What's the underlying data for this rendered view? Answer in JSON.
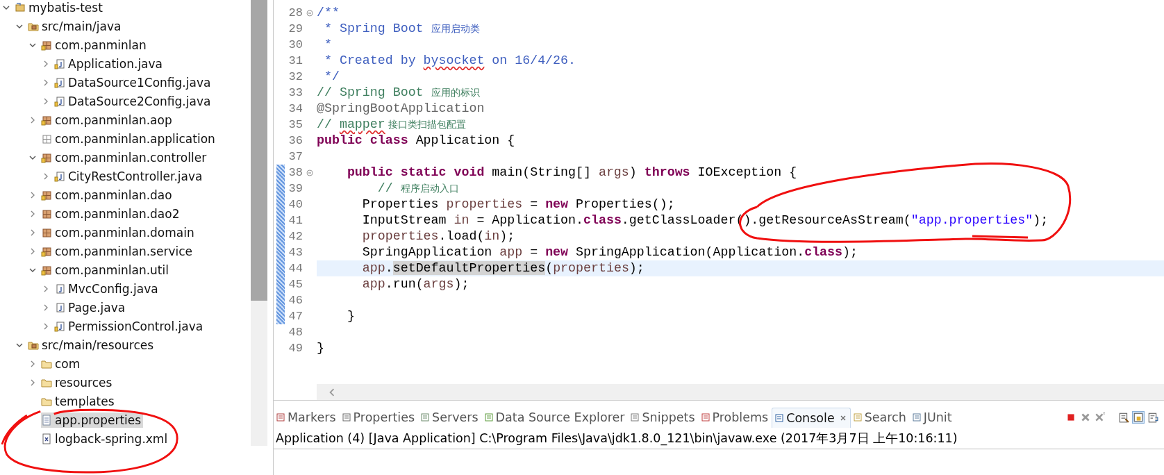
{
  "project_tree": [
    {
      "label": "mybatis-test",
      "kind": "project",
      "selected": false,
      "expanded": true,
      "children": [
        {
          "label": "src/main/java",
          "kind": "source-folder",
          "selected": false,
          "expanded": true,
          "children": [
            {
              "label": "com.panminlan",
              "kind": "package",
              "selected": false,
              "expanded": true,
              "children": [
                {
                  "label": "Application.java",
                  "kind": "java-file",
                  "selected": false,
                  "expanded": false
                },
                {
                  "label": "DataSource1Config.java",
                  "kind": "java-file",
                  "selected": false,
                  "expanded": false
                },
                {
                  "label": "DataSource2Config.java",
                  "kind": "java-file",
                  "selected": false,
                  "expanded": false
                }
              ]
            },
            {
              "label": "com.panminlan.aop",
              "kind": "package",
              "selected": false,
              "expanded": false
            },
            {
              "label": "com.panminlan.application",
              "kind": "empty-package",
              "selected": false
            },
            {
              "label": "com.panminlan.controller",
              "kind": "package",
              "selected": false,
              "expanded": true,
              "children": [
                {
                  "label": "CityRestController.java",
                  "kind": "java-file",
                  "selected": false,
                  "expanded": false
                }
              ]
            },
            {
              "label": "com.panminlan.dao",
              "kind": "package",
              "selected": false,
              "expanded": false
            },
            {
              "label": "com.panminlan.dao2",
              "kind": "plain-package",
              "selected": false,
              "expanded": false
            },
            {
              "label": "com.panminlan.domain",
              "kind": "plain-package",
              "selected": false,
              "expanded": false
            },
            {
              "label": "com.panminlan.service",
              "kind": "package",
              "selected": false,
              "expanded": false
            },
            {
              "label": "com.panminlan.util",
              "kind": "package",
              "selected": false,
              "expanded": true,
              "children": [
                {
                  "label": "MvcConfig.java",
                  "kind": "plain-java-file",
                  "selected": false,
                  "expanded": false
                },
                {
                  "label": "Page.java",
                  "kind": "plain-java-file",
                  "selected": false,
                  "expanded": false
                },
                {
                  "label": "PermissionControl.java",
                  "kind": "java-file",
                  "selected": false,
                  "expanded": false
                }
              ]
            }
          ]
        },
        {
          "label": "src/main/resources",
          "kind": "source-folder",
          "selected": false,
          "expanded": true,
          "children": [
            {
              "label": "com",
              "kind": "folder",
              "selected": false,
              "expanded": false
            },
            {
              "label": "resources",
              "kind": "folder",
              "selected": false,
              "expanded": false
            },
            {
              "label": "templates",
              "kind": "folder",
              "selected": false
            },
            {
              "label": "app.properties",
              "kind": "text-file",
              "selected": true
            },
            {
              "label": "logback-spring.xml",
              "kind": "xml-file",
              "selected": false
            }
          ]
        }
      ]
    }
  ],
  "editor": {
    "lines": [
      {
        "number": "28",
        "fold": true,
        "changed": false,
        "current": false,
        "tokens": [
          {
            "kind": "doc",
            "text": "/**"
          }
        ]
      },
      {
        "number": "29",
        "fold": false,
        "changed": false,
        "current": false,
        "tokens": [
          {
            "kind": "doc",
            "text": " * Spring Boot "
          },
          {
            "kind": "doc-cjk",
            "text": "应用启动类"
          }
        ]
      },
      {
        "number": "30",
        "fold": false,
        "changed": false,
        "current": false,
        "tokens": [
          {
            "kind": "doc",
            "text": " *"
          }
        ]
      },
      {
        "number": "31",
        "fold": false,
        "changed": false,
        "current": false,
        "tokens": [
          {
            "kind": "doc",
            "text": " * Created by "
          },
          {
            "kind": "doc-typo",
            "text": "bysocket"
          },
          {
            "kind": "doc",
            "text": " on 16/4/26."
          }
        ]
      },
      {
        "number": "32",
        "fold": false,
        "changed": false,
        "current": false,
        "tokens": [
          {
            "kind": "doc",
            "text": " */"
          }
        ]
      },
      {
        "number": "33",
        "fold": false,
        "changed": false,
        "current": false,
        "tokens": [
          {
            "kind": "comment",
            "text": "// Spring Boot "
          },
          {
            "kind": "comment-cjk",
            "text": "应用的标识"
          }
        ]
      },
      {
        "number": "34",
        "fold": false,
        "changed": false,
        "current": false,
        "tokens": [
          {
            "kind": "annotation",
            "text": "@SpringBootApplication"
          }
        ]
      },
      {
        "number": "35",
        "fold": false,
        "changed": false,
        "current": false,
        "tokens": [
          {
            "kind": "comment",
            "text": "// "
          },
          {
            "kind": "comment-typo",
            "text": "mapper"
          },
          {
            "kind": "comment-cjk",
            "text": " 接口类扫描包配置"
          }
        ]
      },
      {
        "number": "36",
        "fold": false,
        "changed": false,
        "current": false,
        "tokens": [
          {
            "kind": "keyword",
            "text": "public class "
          },
          {
            "kind": "plain",
            "text": "Application {"
          }
        ]
      },
      {
        "number": "37",
        "fold": false,
        "changed": false,
        "current": false
      },
      {
        "number": "38",
        "fold": true,
        "changed": true,
        "current": false,
        "tokens": [
          {
            "kind": "keyword",
            "text": "    public static void "
          },
          {
            "kind": "plain",
            "text": "main(String[] "
          },
          {
            "kind": "var",
            "text": "args"
          },
          {
            "kind": "plain",
            "text": ") "
          },
          {
            "kind": "keyword",
            "text": "throws "
          },
          {
            "kind": "plain",
            "text": "IOException {"
          }
        ]
      },
      {
        "number": "39",
        "fold": false,
        "changed": true,
        "current": false,
        "tokens": [
          {
            "kind": "comment",
            "text": "        // "
          },
          {
            "kind": "comment-cjk",
            "text": "程序启动入口"
          }
        ]
      },
      {
        "number": "40",
        "fold": false,
        "changed": true,
        "current": false,
        "tokens": [
          {
            "kind": "plain",
            "text": "      Properties "
          },
          {
            "kind": "var",
            "text": "properties"
          },
          {
            "kind": "plain",
            "text": " = "
          },
          {
            "kind": "keyword",
            "text": "new "
          },
          {
            "kind": "plain",
            "text": "Properties();"
          }
        ]
      },
      {
        "number": "41",
        "fold": false,
        "changed": true,
        "current": false,
        "tokens": [
          {
            "kind": "plain",
            "text": "      InputStream "
          },
          {
            "kind": "var",
            "text": "in"
          },
          {
            "kind": "plain",
            "text": " = Application."
          },
          {
            "kind": "keyword",
            "text": "class"
          },
          {
            "kind": "plain",
            "text": ".getClassLoader().getResourceAsStream("
          },
          {
            "kind": "string",
            "text": "\"app.properties\""
          },
          {
            "kind": "plain",
            "text": ");"
          }
        ]
      },
      {
        "number": "42",
        "fold": false,
        "changed": true,
        "current": false,
        "tokens": [
          {
            "kind": "var",
            "text": "      properties"
          },
          {
            "kind": "plain",
            "text": ".load("
          },
          {
            "kind": "var",
            "text": "in"
          },
          {
            "kind": "plain",
            "text": ");"
          }
        ]
      },
      {
        "number": "43",
        "fold": false,
        "changed": true,
        "current": false,
        "tokens": [
          {
            "kind": "plain",
            "text": "      SpringApplication "
          },
          {
            "kind": "var",
            "text": "app"
          },
          {
            "kind": "plain",
            "text": " = "
          },
          {
            "kind": "keyword",
            "text": "new "
          },
          {
            "kind": "plain",
            "text": "SpringApplication(Application."
          },
          {
            "kind": "keyword",
            "text": "class"
          },
          {
            "kind": "plain",
            "text": ");"
          }
        ]
      },
      {
        "number": "44",
        "fold": false,
        "changed": true,
        "current": true,
        "tokens": [
          {
            "kind": "var",
            "text": "      app"
          },
          {
            "kind": "plain",
            "text": "."
          },
          {
            "kind": "occurrence",
            "text": "setDefaultProperties"
          },
          {
            "kind": "plain",
            "text": "("
          },
          {
            "kind": "var",
            "text": "properties"
          },
          {
            "kind": "plain",
            "text": ");"
          }
        ]
      },
      {
        "number": "45",
        "fold": false,
        "changed": true,
        "current": false,
        "tokens": [
          {
            "kind": "var",
            "text": "      app"
          },
          {
            "kind": "plain",
            "text": ".run("
          },
          {
            "kind": "var",
            "text": "args"
          },
          {
            "kind": "plain",
            "text": ");"
          }
        ]
      },
      {
        "number": "46",
        "fold": false,
        "changed": true,
        "current": false
      },
      {
        "number": "47",
        "fold": false,
        "changed": true,
        "current": false,
        "tokens": [
          {
            "kind": "plain",
            "text": "    }"
          }
        ]
      },
      {
        "number": "48",
        "fold": false,
        "changed": false,
        "current": false
      },
      {
        "number": "49",
        "fold": false,
        "changed": false,
        "current": false,
        "tokens": [
          {
            "kind": "plain",
            "text": "}"
          }
        ]
      }
    ]
  },
  "bottom_panel": {
    "tabs": [
      {
        "label": "Markers",
        "selected": false
      },
      {
        "label": "Properties",
        "selected": false
      },
      {
        "label": "Servers",
        "selected": false
      },
      {
        "label": "Data Source Explorer",
        "selected": false
      },
      {
        "label": "Snippets",
        "selected": false
      },
      {
        "label": "Problems",
        "selected": false
      },
      {
        "label": "Console",
        "selected": true
      },
      {
        "label": "Search",
        "selected": false
      },
      {
        "label": "JUnit",
        "selected": false
      }
    ],
    "console_title": "Application (4) [Java Application] C:\\Program Files\\Java\\jdk1.8.0_121\\bin\\javaw.exe (2017年3月7日 上午10:16:11)"
  }
}
